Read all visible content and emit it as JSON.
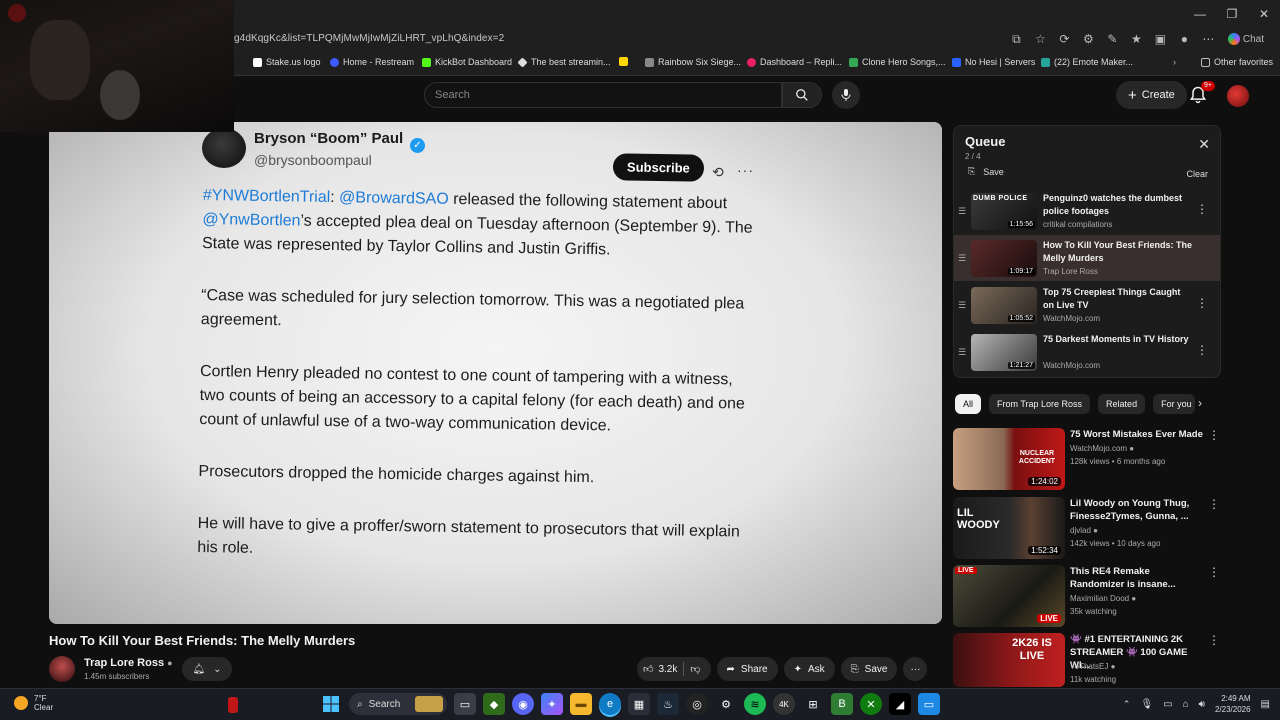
{
  "browser": {
    "url": "g4dKqgKc&list=TLPQMjMwMjIwMjZiLHRT_vpLhQ&index=2",
    "chat_label": "Chat",
    "bookmarks": [
      {
        "label": "Stake.us logo",
        "color": "#ffffff"
      },
      {
        "label": "Home - Restream",
        "color": "#3b5bff"
      },
      {
        "label": "KickBot Dashboard",
        "color": "#53fc18"
      },
      {
        "label": "The best streamin...",
        "color": "#dddddd"
      },
      {
        "label": "Rainbow Six Siege...",
        "color": "#aaaaaa"
      },
      {
        "label": "Dashboard – Repli...",
        "color": "#e91e63"
      },
      {
        "label": "Clone Hero Songs,...",
        "color": "#34a853"
      },
      {
        "label": "No Hesi | Servers",
        "color": "#2962ff"
      },
      {
        "label": "(22) Emote Maker...",
        "color": "#26a69a"
      },
      {
        "label": "Other favorites",
        "color": "#bbbbbb"
      }
    ]
  },
  "header": {
    "search_placeholder": "Search",
    "create_label": "Create",
    "notif_badge": "9+"
  },
  "video": {
    "tweet": {
      "name": "Bryson “Boom” Paul",
      "handle": "@brysonboompaul",
      "subscribe": "Subscribe",
      "p1_tag": "#YNWBortlenTrial",
      "p1_colon": ": ",
      "p1_mention1": "@BrowardSAO",
      "p1_mid": " released the following statement about ",
      "p1_mention2": "@YnwBortlen",
      "p1_rest": "’s accepted plea deal on Tuesday afternoon (September 9). The State was represented by Taylor Collins and Justin Griffis.",
      "p2": "“Case was scheduled for jury selection tomorrow. This was a negotiated plea agreement.",
      "p3": "Cortlen Henry pleaded no contest to one count of tampering with a witness, two counts of being an accessory to a capital felony (for each death) and one count of unlawful use of a two-way communication device.",
      "p4": "Prosecutors dropped the homicide charges against him.",
      "p5": "He will have to give a proffer/sworn statement to prosecutors that will explain his role."
    },
    "title": "How To Kill Your Best Friends: The Melly Murders",
    "channel": "Trap Lore Ross",
    "subscribers": "1.45m subscribers",
    "likes": "3.2k",
    "share": "Share",
    "ask": "Ask",
    "save": "Save"
  },
  "queue": {
    "title": "Queue",
    "count": "2 / 4",
    "save": "Save",
    "clear": "Clear",
    "items": [
      {
        "title": "Penguinz0 watches the dumbest police footages",
        "channel": "critikal compilations",
        "duration": "1:15:56",
        "thumb_text": "DUMB POLICE"
      },
      {
        "title": "How To Kill Your Best Friends: The Melly Murders",
        "channel": "Trap Lore Ross",
        "duration": "1:09:17"
      },
      {
        "title": "Top 75 Creepiest Things Caught on Live TV",
        "channel": "WatchMojo.com",
        "duration": "1:05:52"
      },
      {
        "title": "75 Darkest Moments in TV History",
        "channel": "WatchMojo.com",
        "duration": "1:21:27"
      }
    ]
  },
  "chips": [
    "All",
    "From Trap Lore Ross",
    "Related",
    "For you"
  ],
  "related": [
    {
      "title": "75 Worst Mistakes Ever Made",
      "channel": "WatchMojo.com",
      "meta": "128k views • 6 months ago",
      "duration": "1:24:02",
      "thumb_text": "NUCLEAR ACCIDENT"
    },
    {
      "title": "Lil Woody on Young Thug, Finesse2Tymes, Gunna, ...",
      "channel": "djvlad",
      "meta": "142k views • 10 days ago",
      "duration": "1:52:34",
      "thumb_text": "LIL WOODY"
    },
    {
      "title": "This RE4 Remake Randomizer is insane...",
      "channel": "Maximilian Dood",
      "meta": "35k watching",
      "live": "LIVE",
      "live_tl": "LIVE"
    },
    {
      "title": "👾 #1 ENTERTAINING 2K STREAMER 👾 100 GAME WI...",
      "channel": "YoThatsEJ",
      "meta": "11k watching",
      "thumb_text": "2K26 IS LIVE"
    }
  ],
  "taskbar": {
    "temp": "7°F",
    "condition": "Clear",
    "search": "Search",
    "time": "2:49 AM",
    "date": "2/23/2026"
  }
}
